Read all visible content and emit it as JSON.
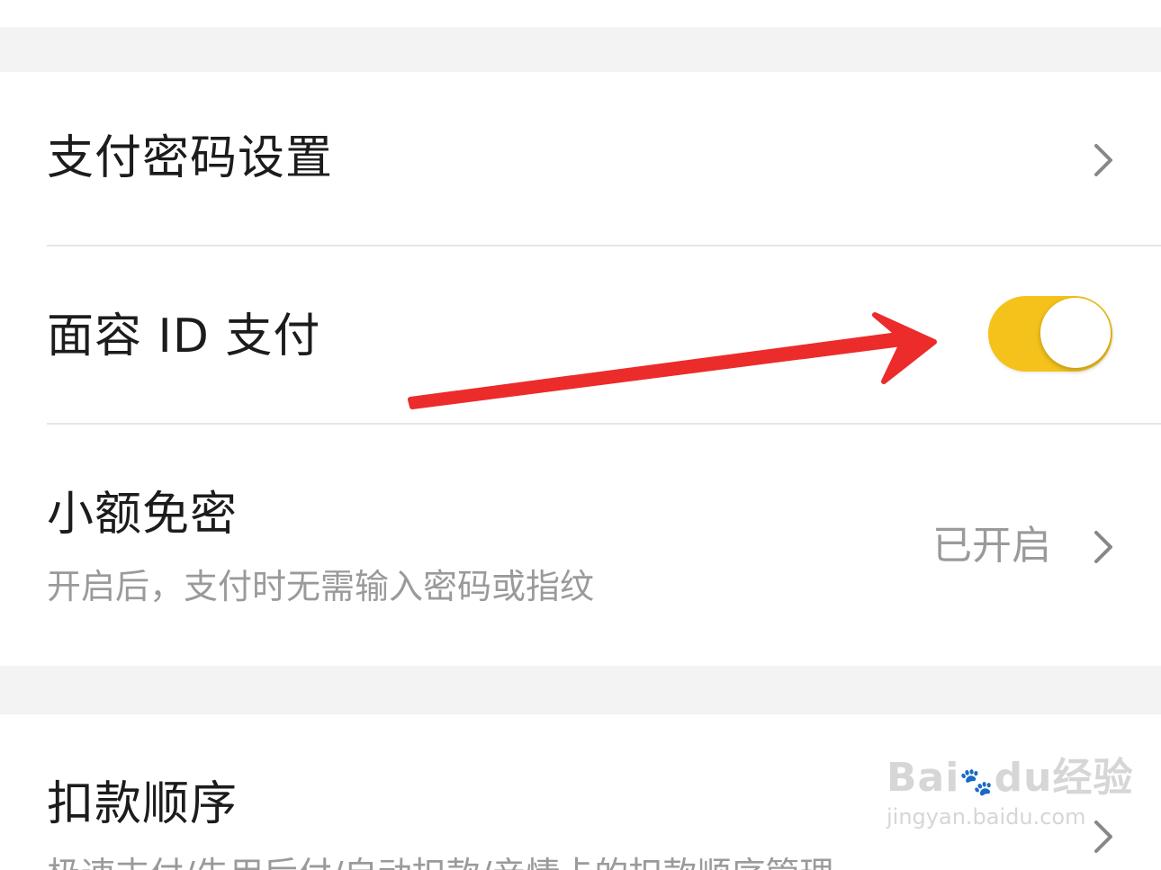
{
  "rows": {
    "pay_password": {
      "title": "支付密码设置"
    },
    "face_id": {
      "title": "面容 ID 支付",
      "enabled": true
    },
    "small_amount": {
      "title": "小额免密",
      "subtitle": "开启后，支付时无需输入密码或指纹",
      "value": "已开启"
    },
    "deduct_order": {
      "title": "扣款顺序",
      "subtitle": "极速支付/先用后付/自动扣款/亲情卡的扣款顺序管理"
    }
  },
  "annotation": {
    "arrow_color": "#ec2b2b"
  },
  "watermark": {
    "brand": "Bai",
    "paw": "du",
    "cn": "经验",
    "url": "jingyan.baidu.com"
  },
  "colors": {
    "toggle_on": "#f4c21a",
    "section_gap": "#f3f3f3"
  }
}
